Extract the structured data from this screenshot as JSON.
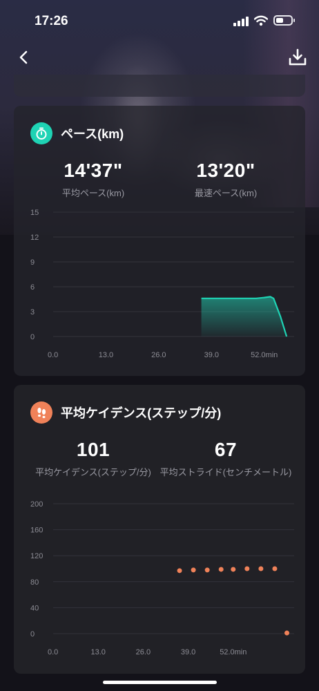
{
  "status_bar": {
    "time": "17:26",
    "signal_icon": "cellular-signal-icon",
    "wifi_icon": "wifi-icon",
    "battery_icon": "battery-icon"
  },
  "nav": {
    "back_icon": "chevron-left-icon",
    "download_icon": "download-icon"
  },
  "pace_card": {
    "icon": "stopwatch-icon",
    "title": "ペース(km)",
    "stats": [
      {
        "value": "14'37\"",
        "label": "平均ペース(km)"
      },
      {
        "value": "13'20\"",
        "label": "最速ペース(km)"
      }
    ]
  },
  "cadence_card": {
    "icon": "footprints-icon",
    "title": "平均ケイデンス(ステップ/分)",
    "stats": [
      {
        "value": "101",
        "label": "平均ケイデンス(ステップ/分)"
      },
      {
        "value": "67",
        "label": "平均ストライド(センチメートル)"
      }
    ]
  },
  "colors": {
    "pace_accent": "#1fd3b4",
    "cadence_accent": "#f08259",
    "card_bg": "#212126",
    "axis_text": "#8d8d95"
  },
  "chart_data": [
    {
      "type": "area",
      "title": "ペース(km)",
      "x": [
        36.5,
        45.0,
        50.0,
        52.0,
        53.5,
        54.3,
        56.0,
        57.5
      ],
      "values": [
        4.6,
        4.6,
        4.6,
        4.7,
        4.8,
        4.6,
        2.4,
        0
      ],
      "xlim": [
        0,
        58
      ],
      "ylim": [
        0,
        15
      ],
      "x_ticks": [
        "0.0",
        "13.0",
        "26.0",
        "39.0",
        "52.0min"
      ],
      "x_tick_values": [
        0,
        13,
        26,
        39,
        52
      ],
      "y_ticks": [
        "15",
        "12",
        "9",
        "6",
        "3",
        "0"
      ],
      "y_tick_values": [
        15,
        12,
        9,
        6,
        3,
        0
      ],
      "grid": true,
      "color": "#1fd3b4"
    },
    {
      "type": "scatter",
      "title": "平均ケイデンス(ステップ/分)",
      "x": [
        36.5,
        40.5,
        44.5,
        48.5,
        52.0,
        56.0,
        60.0,
        64.0,
        67.5
      ],
      "values": [
        97,
        98,
        98,
        99,
        99,
        100,
        100,
        100,
        1
      ],
      "xlim": [
        0,
        68
      ],
      "ylim": [
        0,
        200
      ],
      "x_ticks": [
        "0.0",
        "13.0",
        "26.0",
        "39.0",
        "52.0min"
      ],
      "x_tick_values": [
        0,
        13,
        26,
        39,
        52
      ],
      "y_ticks": [
        "200",
        "160",
        "120",
        "80",
        "40",
        "0"
      ],
      "y_tick_values": [
        200,
        160,
        120,
        80,
        40,
        0
      ],
      "grid": true,
      "color": "#f08259"
    }
  ]
}
